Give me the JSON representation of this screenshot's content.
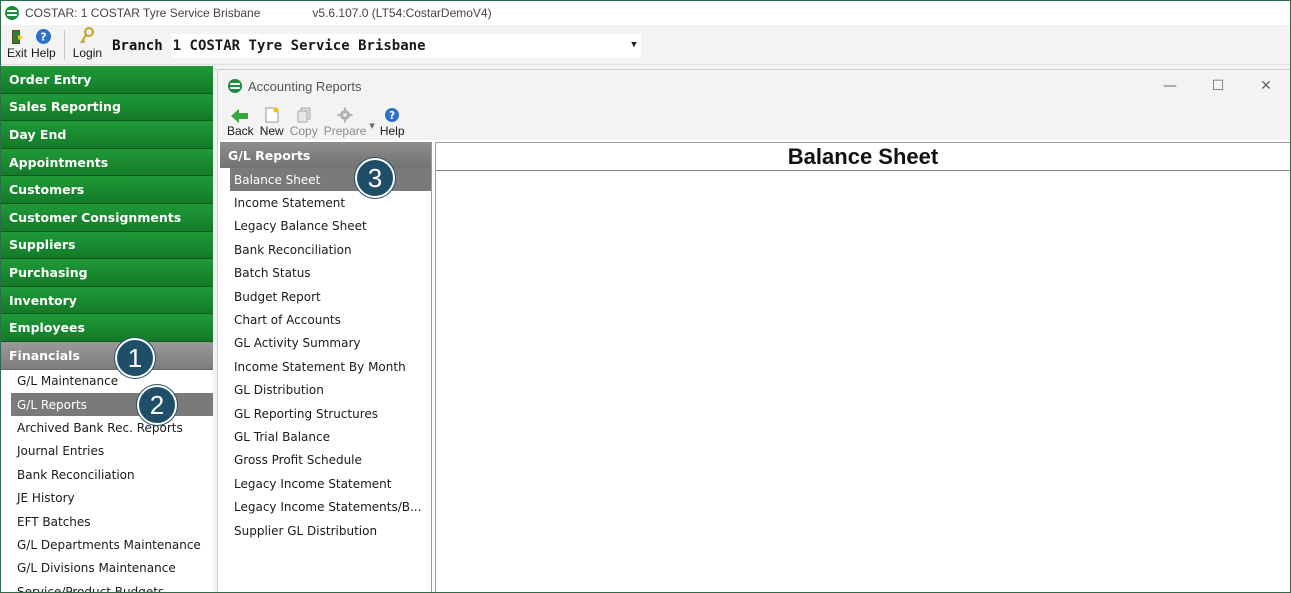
{
  "app": {
    "title": "COSTAR:  1 COSTAR Tyre Service Brisbane",
    "version": "v5.6.107.0  (LT54:CostarDemoV4)"
  },
  "toolbar": {
    "exit_label": "Exit",
    "help_label": "Help",
    "login_label": "Login",
    "branch_label": "Branch",
    "branch_value": "1  COSTAR Tyre Service Brisbane"
  },
  "sidebar": {
    "sections": [
      {
        "label": "Order Entry"
      },
      {
        "label": "Sales Reporting"
      },
      {
        "label": "Day End"
      },
      {
        "label": "Appointments"
      },
      {
        "label": "Customers"
      },
      {
        "label": "Customer Consignments"
      },
      {
        "label": "Suppliers"
      },
      {
        "label": "Purchasing"
      },
      {
        "label": "Inventory"
      },
      {
        "label": "Employees"
      },
      {
        "label": "Financials"
      }
    ],
    "financials_items": [
      {
        "label": "G/L Maintenance"
      },
      {
        "label": "G/L Reports"
      },
      {
        "label": "Archived Bank Rec. Reports"
      },
      {
        "label": "Journal Entries"
      },
      {
        "label": "Bank Reconciliation"
      },
      {
        "label": "JE History"
      },
      {
        "label": "EFT Batches"
      },
      {
        "label": "G/L Departments Maintenance"
      },
      {
        "label": "G/L Divisions Maintenance"
      },
      {
        "label": "Service/Product Budgets"
      }
    ]
  },
  "window": {
    "title": "Accounting Reports",
    "minimize": "—",
    "maximize": "☐",
    "close": "✕",
    "toolbar": {
      "back_label": "Back",
      "new_label": "New",
      "copy_label": "Copy",
      "prepare_label": "Prepare",
      "help_label": "Help"
    }
  },
  "reports": {
    "header": "G/L Reports",
    "items": [
      {
        "label": "Balance Sheet"
      },
      {
        "label": "Income Statement"
      },
      {
        "label": "Legacy Balance Sheet"
      },
      {
        "label": "Bank Reconciliation"
      },
      {
        "label": "Batch Status"
      },
      {
        "label": "Budget Report"
      },
      {
        "label": "Chart of Accounts"
      },
      {
        "label": "GL Activity Summary"
      },
      {
        "label": "Income Statement By Month"
      },
      {
        "label": "GL Distribution"
      },
      {
        "label": "GL Reporting Structures"
      },
      {
        "label": "GL Trial Balance"
      },
      {
        "label": "Gross Profit Schedule"
      },
      {
        "label": "Legacy Income Statement"
      },
      {
        "label": "Legacy Income Statements/B..."
      },
      {
        "label": "Supplier GL Distribution"
      }
    ]
  },
  "content": {
    "title": "Balance Sheet"
  },
  "callouts": [
    "1",
    "2",
    "3"
  ],
  "colors": {
    "nav_green": "#1f9a38",
    "nav_active": "#8a8a8a",
    "callout": "#1f4f68"
  }
}
